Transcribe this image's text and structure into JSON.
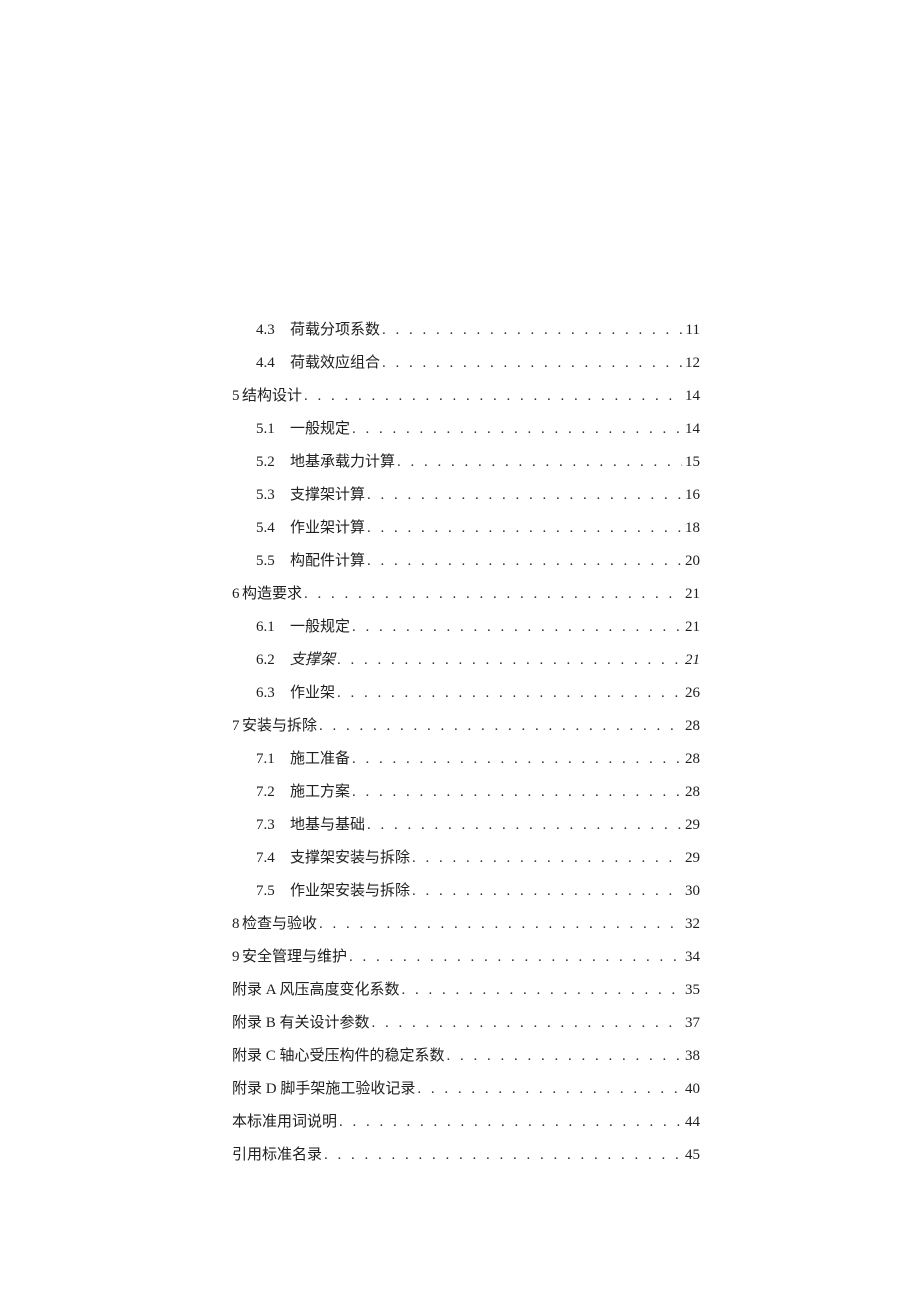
{
  "entries": [
    {
      "level": 2,
      "num": "4.3",
      "label": "荷载分项系数",
      "page": "11",
      "italic": false
    },
    {
      "level": 2,
      "num": "4.4",
      "label": "荷载效应组合",
      "page": "12",
      "italic": false
    },
    {
      "level": 1,
      "num": "5",
      "label": "结构设计",
      "page": "14",
      "italic": false
    },
    {
      "level": 2,
      "num": "5.1",
      "label": "一般规定",
      "page": "14",
      "italic": false,
      "nospacer": true
    },
    {
      "level": 2,
      "num": "5.2",
      "label": "地基承载力计算",
      "page": "15",
      "italic": false,
      "nospacer": true
    },
    {
      "level": 2,
      "num": "5.3",
      "label": "支撑架计算",
      "page": "16",
      "italic": false
    },
    {
      "level": 2,
      "num": "5.4",
      "label": "作业架计算",
      "page": "18",
      "italic": false
    },
    {
      "level": 2,
      "num": "5.5",
      "label": "构配件计算",
      "page": "20",
      "italic": false
    },
    {
      "level": 1,
      "num": "6",
      "label": "构造要求",
      "page": "21",
      "italic": false
    },
    {
      "level": 2,
      "num": "6.1",
      "label": "一般规定",
      "page": "21",
      "italic": false
    },
    {
      "level": 2,
      "num": "6.2",
      "label": "支撑架",
      "page": "21",
      "italic": true
    },
    {
      "level": 2,
      "num": "6.3",
      "label": "作业架",
      "page": "26",
      "italic": false
    },
    {
      "level": 1,
      "num": "7",
      "label": "安装与拆除",
      "page": "28",
      "italic": false
    },
    {
      "level": 2,
      "num": "7.1",
      "label": "施工准备",
      "page": "28",
      "italic": false
    },
    {
      "level": 2,
      "num": "7.2",
      "label": "施工方案",
      "page": "28",
      "italic": false
    },
    {
      "level": 2,
      "num": "7.3",
      "label": "地基与基础",
      "page": "29",
      "italic": false
    },
    {
      "level": 2,
      "num": "7.4",
      "label": "支撑架安装与拆除",
      "page": "29",
      "italic": false
    },
    {
      "level": 2,
      "num": "7.5",
      "label": "作业架安装与拆除",
      "page": "30",
      "italic": false
    },
    {
      "level": 1,
      "num": "8",
      "label": "检查与验收",
      "page": "32",
      "italic": false
    },
    {
      "level": 1,
      "num": "9",
      "label": "安全管理与维护",
      "page": "34",
      "italic": false
    },
    {
      "level": 1,
      "num": "",
      "label": "附录 A 风压高度变化系数",
      "page": "35",
      "italic": false
    },
    {
      "level": 1,
      "num": "",
      "label": "附录 B 有关设计参数",
      "page": "37",
      "italic": false
    },
    {
      "level": 1,
      "num": "",
      "label": "附录 C 轴心受压构件的稳定系数",
      "page": "38",
      "italic": false
    },
    {
      "level": 1,
      "num": "",
      "label": "附录 D 脚手架施工验收记录",
      "page": "40",
      "italic": false
    },
    {
      "level": 1,
      "num": "",
      "label": "本标准用词说明",
      "page": "44",
      "italic": false
    },
    {
      "level": 1,
      "num": "",
      "label": "引用标准名录",
      "page": "45",
      "italic": false
    }
  ],
  "dots": ". . . . . . . . . . . . . . . . . . . . . . . . . . . . . . . . . . . . . . . . . . . . . . . . . . . . . . . . . . . . . . . . . . . . . . . . . . . . . . . . . . . . . . . . . ."
}
